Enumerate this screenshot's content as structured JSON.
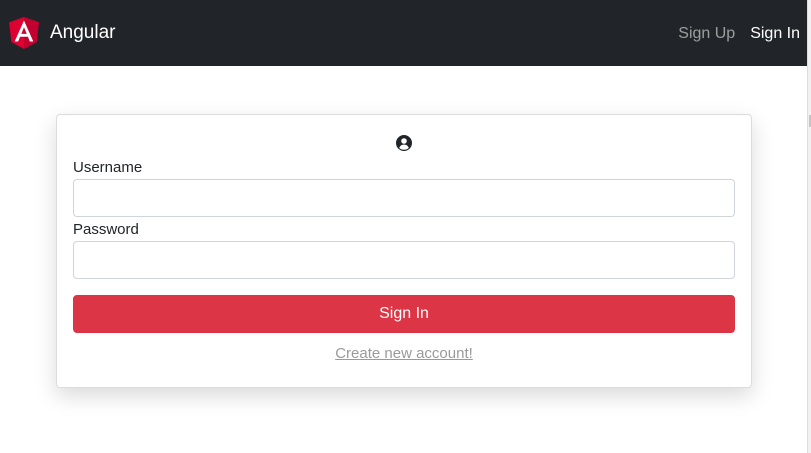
{
  "navbar": {
    "brand_name": "Angular",
    "logo_icon": "angular-logo",
    "links": [
      {
        "label": "Sign Up",
        "state": "muted"
      },
      {
        "label": "Sign In",
        "state": "active"
      }
    ],
    "background": "#212529"
  },
  "form": {
    "user_icon": "user-circle-icon",
    "username_label": "Username",
    "username_value": "",
    "password_label": "Password",
    "password_value": "",
    "submit_label": "Sign In",
    "create_account_link": "Create new account!"
  },
  "colors": {
    "primary_button": "#dc3545",
    "angular_red": "#dd0031"
  }
}
